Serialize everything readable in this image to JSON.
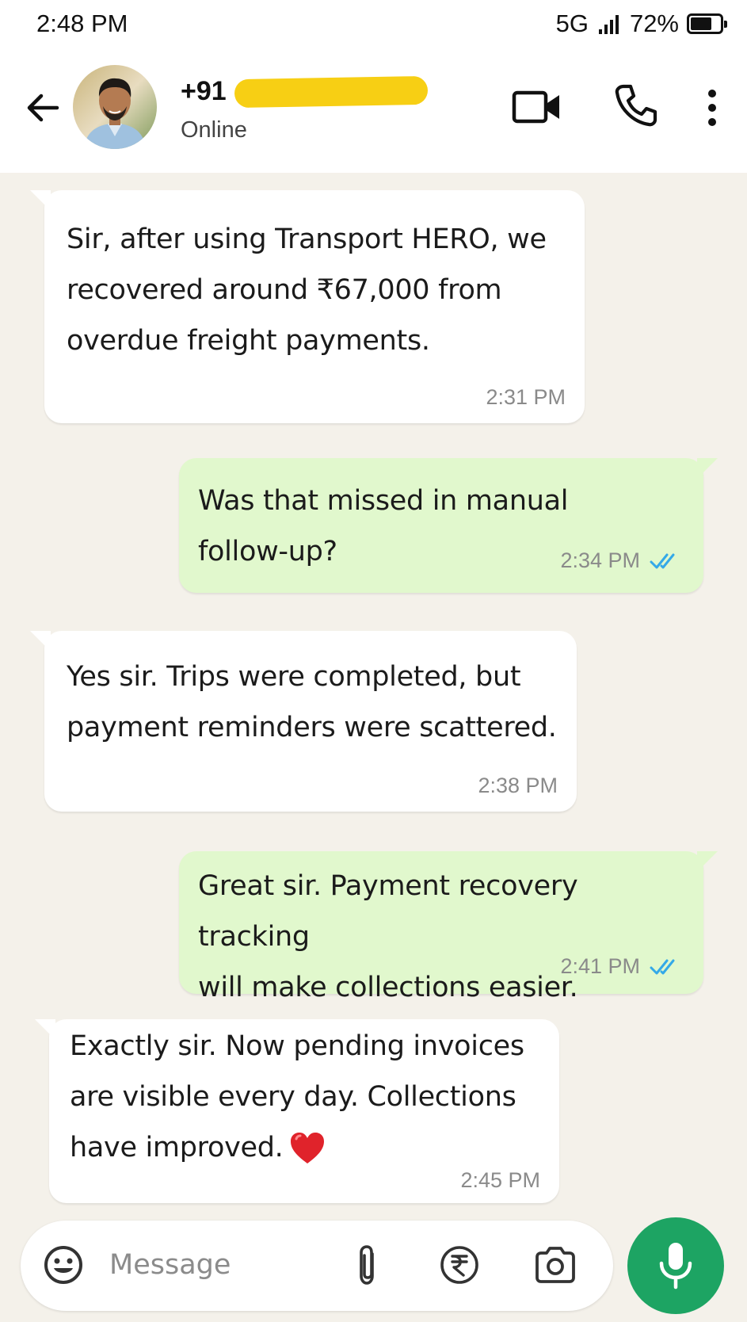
{
  "status_bar": {
    "time": "2:48 PM",
    "network": "5G",
    "battery_percent": "72%",
    "battery_level": 0.72
  },
  "header": {
    "contact_number": "+91",
    "contact_status": "Online",
    "redaction_color": "#f7cf14",
    "icons": [
      "back-arrow-icon",
      "video-call-icon",
      "voice-call-icon",
      "more-options-icon"
    ]
  },
  "messages": [
    {
      "direction": "incoming",
      "text": "Sir, after using Transport HERO, we\nrecovered around ₹67,000 from\noverdue freight payments.",
      "time": "2:31 PM"
    },
    {
      "direction": "outgoing",
      "text": "Was that missed in manual\nfollow-up?",
      "time": "2:34 PM",
      "read": true
    },
    {
      "direction": "incoming",
      "text": "Yes sir. Trips were completed, but\npayment reminders were scattered.",
      "time": "2:38 PM"
    },
    {
      "direction": "outgoing",
      "text": "Great sir. Payment recovery tracking\nwill make collections easier.",
      "time": "2:41 PM",
      "read": true
    },
    {
      "direction": "incoming",
      "text": "Exactly sir. Now pending invoices\nare visible every day. Collections\nhave improved.",
      "time": "2:45 PM",
      "emoji": "red-heart-icon"
    }
  ],
  "composer": {
    "placeholder": "Message",
    "icons": [
      "emoji-icon",
      "attach-icon",
      "rupee-payment-icon",
      "camera-icon",
      "mic-icon"
    ]
  },
  "colors": {
    "chat_background": "#f4f1ea",
    "incoming_bubble": "#ffffff",
    "outgoing_bubble": "#e1f8cd",
    "read_ticks": "#34a9e8",
    "mic_button": "#1da463"
  }
}
